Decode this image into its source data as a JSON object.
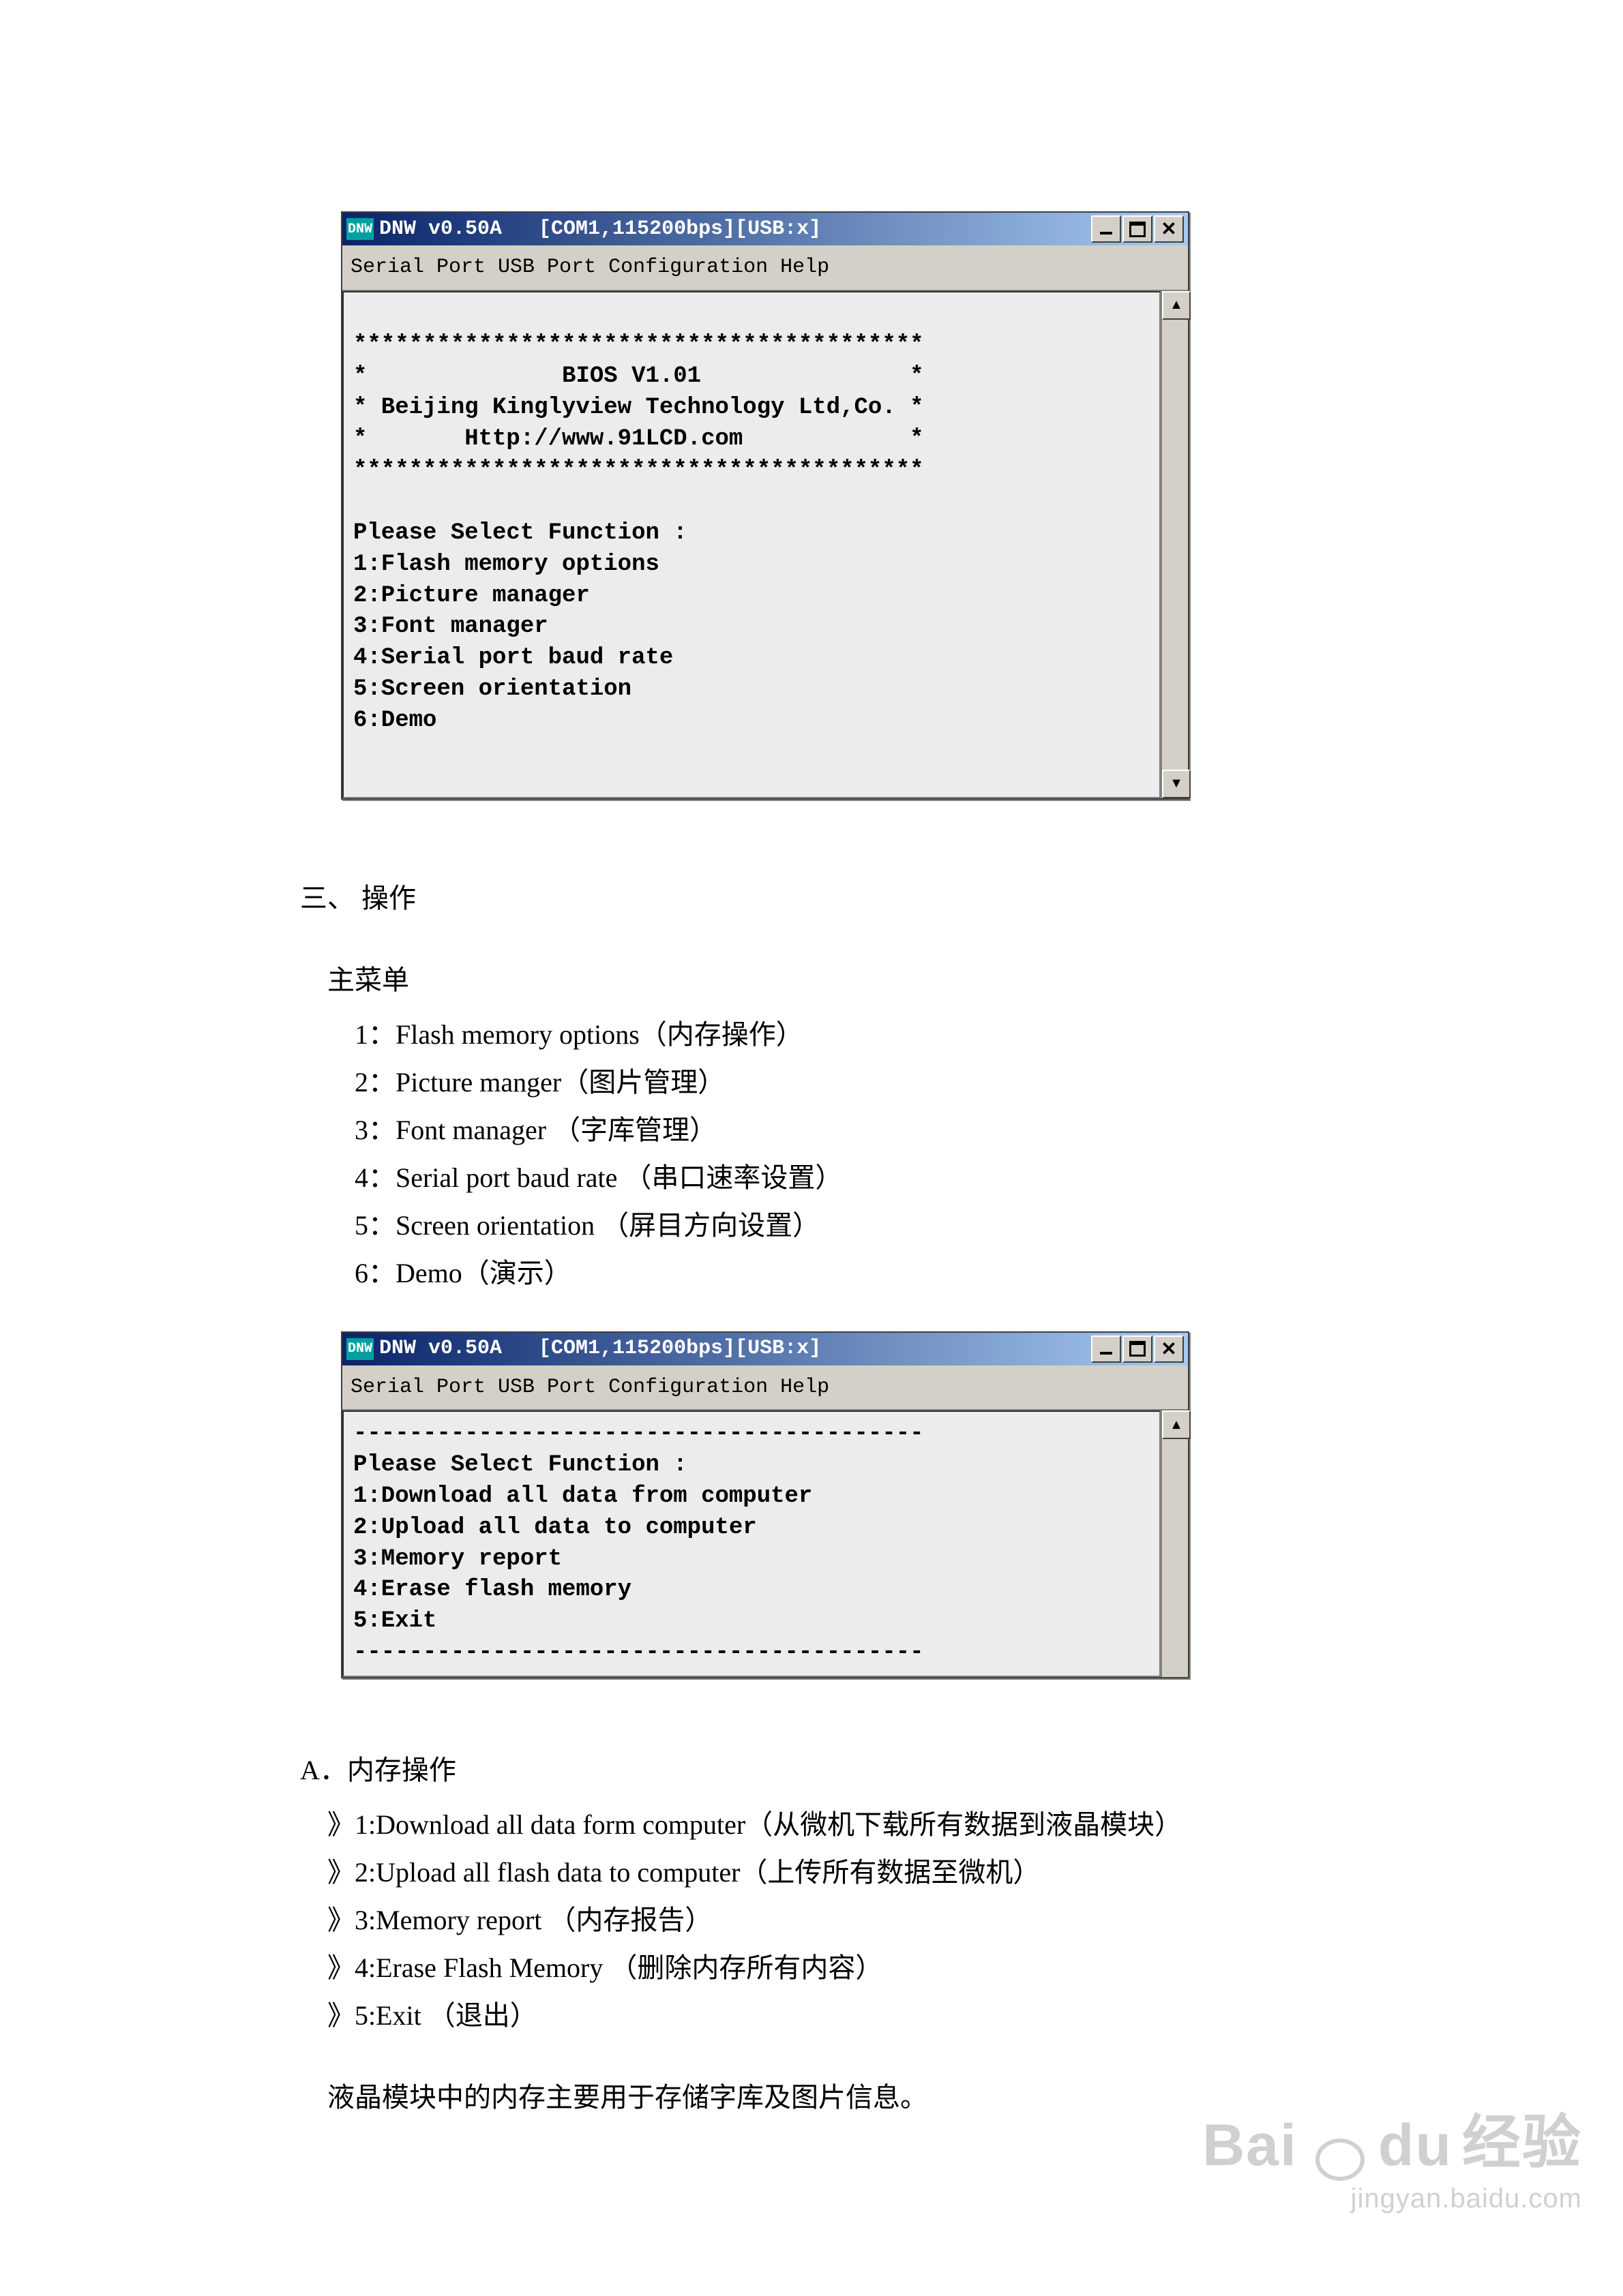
{
  "window1": {
    "icon": "DNW",
    "title": "DNW v0.50A   [COM1,115200bps][USB:x]",
    "menu": [
      "Serial Port",
      "USB Port",
      "Configuration",
      "Help"
    ],
    "content": "\n*****************************************\n*              BIOS V1.01               *\n* Beijing Kinglyview Technology Ltd,Co. *\n*       Http://www.91LCD.com            *\n*****************************************\n\nPlease Select Function :\n1:Flash memory options\n2:Picture manager\n3:Font manager\n4:Serial port baud rate\n5:Screen orientation\n6:Demo"
  },
  "section3": {
    "heading": "三、 操作",
    "sub": "主菜单",
    "items": [
      "1：Flash memory options（内存操作）",
      "2：Picture manger（图片管理）",
      "3：Font manager （字库管理）",
      "4：Serial port baud rate （串口速率设置）",
      "5：Screen orientation  （屏目方向设置）",
      "6：Demo（演示）"
    ]
  },
  "window2": {
    "icon": "DNW",
    "title": "DNW v0.50A   [COM1,115200bps][USB:x]",
    "menu": [
      "Serial Port",
      "USB Port",
      "Configuration",
      "Help"
    ],
    "content": "-----------------------------------------\nPlease Select Function :\n1:Download all data from computer\n2:Upload all data to computer\n3:Memory report\n4:Erase flash memory\n5:Exit\n-----------------------------------------"
  },
  "sectionA": {
    "heading": "A．内存操作",
    "items": [
      "》1:Download all data form computer（从微机下载所有数据到液晶模块）",
      "》2:Upload all flash data to computer（上传所有数据至微机）",
      "》3:Memory report （内存报告）",
      "》4:Erase Flash Memory （删除内存所有内容）",
      "》5:Exit （退出）"
    ],
    "footnote": "液晶模块中的内存主要用于存储字库及图片信息。"
  },
  "watermark": {
    "brand_cn": "经验",
    "url": "jingyan.baidu.com"
  }
}
